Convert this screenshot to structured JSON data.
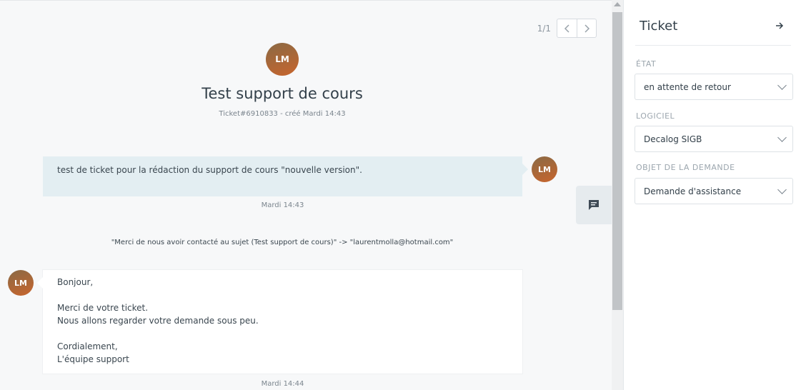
{
  "pager": {
    "count": "1/1",
    "prev_icon": "chevron-left-icon",
    "next_icon": "chevron-right-icon"
  },
  "ticket": {
    "avatar_initials": "LM",
    "title": "Test support de cours",
    "meta": "Ticket#6910833 - créé Mardi 14:43"
  },
  "messages": [
    {
      "avatar_initials": "LM",
      "text": "test de ticket pour la rédaction du support de cours \"nouvelle version\".",
      "time": "Mardi 14:43"
    },
    {
      "avatar_initials": "LM",
      "lines": [
        "Bonjour,",
        "",
        "Merci de votre ticket.",
        "Nous allons regarder votre demande sous peu.",
        "",
        "Cordialement,",
        "L'équipe support"
      ],
      "time": "Mardi 14:44"
    }
  ],
  "system_note": "\"Merci de nous avoir contacté au sujet (Test support de cours)\" -> \"laurentmolla@hotmail.com\"",
  "compose_icon": "chat-bubble-icon",
  "sidebar": {
    "title": "Ticket",
    "close_icon": "arrow-right-icon",
    "fields": [
      {
        "label": "ÉTAT",
        "value": "en attente de retour"
      },
      {
        "label": "LOGICIEL",
        "value": "Decalog SIGB"
      },
      {
        "label": "OBJET DE LA DEMANDE",
        "value": "Demande d'assistance"
      }
    ]
  },
  "colors": {
    "accent_avatar": "#c8652d",
    "customer_bubble": "#e3eef2",
    "agent_bubble": "#ffffff"
  }
}
